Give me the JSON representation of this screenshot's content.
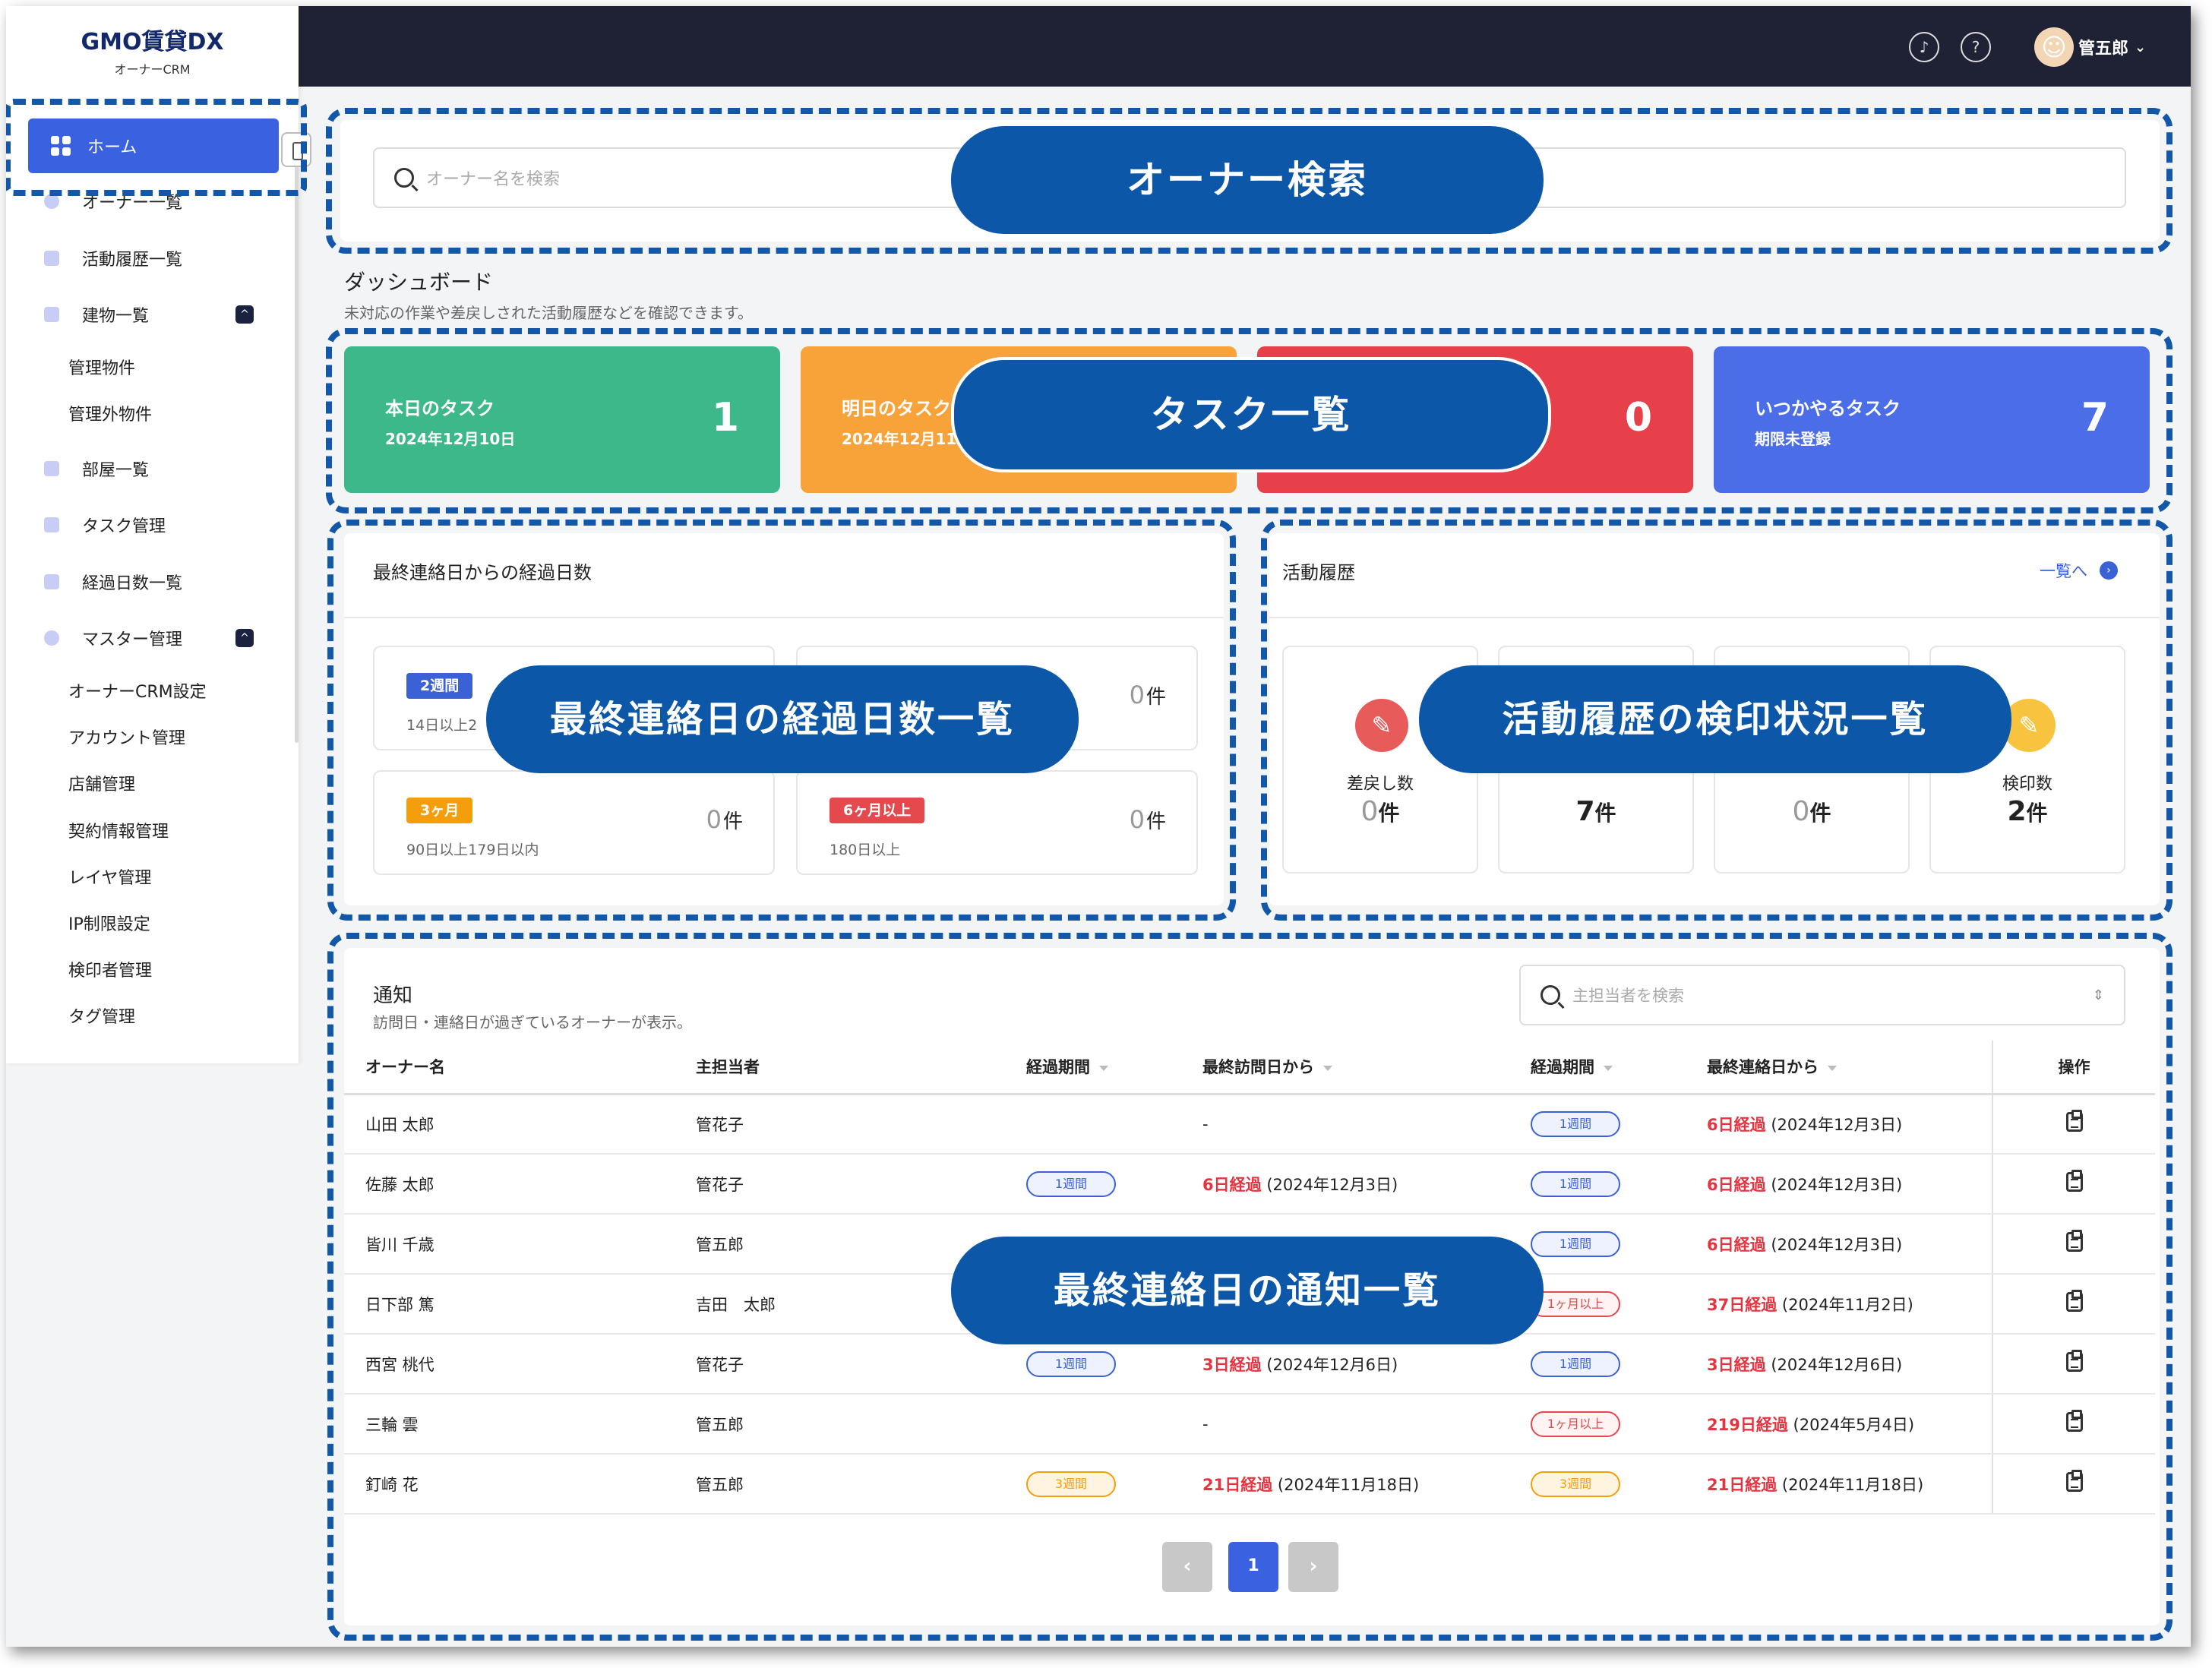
{
  "app": {
    "brand": "GMO賃貸DX",
    "product": "オーナーCRM"
  },
  "sidebar": {
    "home": "ホーム",
    "items": [
      "オーナー一覧",
      "活動履歴一覧",
      "建物一覧",
      "管理物件",
      "管理外物件",
      "部屋一覧",
      "タスク管理",
      "経過日数一覧",
      "マスター管理",
      "オーナーCRM設定",
      "アカウント管理",
      "店舗管理",
      "契約情報管理",
      "レイヤ管理",
      "IP制限設定",
      "検印者管理",
      "タグ管理"
    ]
  },
  "header": {
    "user": "管五郎"
  },
  "search": {
    "placeholder": "オーナー名を検索"
  },
  "dashboard": {
    "title": "ダッシュボード",
    "desc": "未対応の作業や差戻しされた活動履歴などを確認できます。"
  },
  "tasks": [
    {
      "title": "本日のタスク",
      "date": "2024年12月10日",
      "count": "1",
      "color": "#3cb88a"
    },
    {
      "title": "明日のタスク",
      "date": "2024年12月11日",
      "count": "",
      "color": "#f8a23a"
    },
    {
      "title": "",
      "date": "",
      "count": "0",
      "color": "#e8404a"
    },
    {
      "title": "いつかやるタスク",
      "date": "期限未登録",
      "count": "7",
      "color": "#4b6ee8"
    }
  ],
  "elapsed": {
    "title": "最終連絡日からの経過日数",
    "unit": "件",
    "items": [
      {
        "badge": "2週間",
        "sub": "14日以上2",
        "count": "",
        "color": "#3b61d6"
      },
      {
        "badge": "",
        "sub": "",
        "count": "0",
        "color": "#3b61d6"
      },
      {
        "badge": "3ヶ月",
        "sub": "90日以上179日以内",
        "count": "0",
        "color": "#f59e0b"
      },
      {
        "badge": "6ヶ月以上",
        "sub": "180日以上",
        "count": "0",
        "color": "#e5484d"
      }
    ]
  },
  "activity": {
    "title": "活動履歴",
    "link": "一覧へ",
    "unit": "件",
    "items": [
      {
        "label": "差戻し数",
        "count": "0"
      },
      {
        "label": "",
        "count": "7"
      },
      {
        "label": "",
        "count": "0"
      },
      {
        "label": "検印数",
        "count": "2"
      }
    ]
  },
  "notice": {
    "title": "通知",
    "desc": "訪問日・連絡日が過ぎているオーナーが表示。",
    "assignee_placeholder": "主担当者を検索",
    "headers": [
      "オーナー名",
      "主担当者",
      "経過期間",
      "最終訪問日から",
      "経過期間",
      "最終連絡日から",
      "操作"
    ],
    "rows": [
      {
        "owner": "山田 太郎",
        "manager": "管花子",
        "vtag": "",
        "vtype": "",
        "vdays": "-",
        "vdate": "",
        "ctag": "1週間",
        "ctype": "blue",
        "cdays": "6日経過",
        "cdate": "(2024年12月3日)"
      },
      {
        "owner": "佐藤 太郎",
        "manager": "管花子",
        "vtag": "1週間",
        "vtype": "blue",
        "vdays": "6日経過",
        "vdate": "(2024年12月3日)",
        "ctag": "1週間",
        "ctype": "blue",
        "cdays": "6日経過",
        "cdate": "(2024年12月3日)"
      },
      {
        "owner": "皆川 千歳",
        "manager": "管五郎",
        "vtag": "",
        "vtype": "",
        "vdays": "",
        "vdate": "",
        "ctag": "1週間",
        "ctype": "blue",
        "cdays": "6日経過",
        "cdate": "(2024年12月3日)"
      },
      {
        "owner": "日下部 篤",
        "manager": "吉田　太郎",
        "vtag": "",
        "vtype": "",
        "vdays": "",
        "vdate": "",
        "ctag": "1ヶ月以上",
        "ctype": "red",
        "cdays": "37日経過",
        "cdate": "(2024年11月2日)"
      },
      {
        "owner": "西宮 桃代",
        "manager": "管花子",
        "vtag": "1週間",
        "vtype": "blue",
        "vdays": "3日経過",
        "vdate": "(2024年12月6日)",
        "ctag": "1週間",
        "ctype": "blue",
        "cdays": "3日経過",
        "cdate": "(2024年12月6日)"
      },
      {
        "owner": "三輪 雲",
        "manager": "管五郎",
        "vtag": "",
        "vtype": "",
        "vdays": "-",
        "vdate": "",
        "ctag": "1ヶ月以上",
        "ctype": "red",
        "cdays": "219日経過",
        "cdate": "(2024年5月4日)"
      },
      {
        "owner": "釘崎 花",
        "manager": "管五郎",
        "vtag": "3週間",
        "vtype": "orange",
        "vdays": "21日経過",
        "vdate": "(2024年11月18日)",
        "ctag": "3週間",
        "ctype": "orange",
        "cdays": "21日経過",
        "cdate": "(2024年11月18日)"
      }
    ]
  },
  "pagination": {
    "current": "1",
    "prev": "‹",
    "next": "›"
  },
  "annotations": {
    "search": "オーナー検索",
    "tasks": "タスク一覧",
    "elapsed": "最終連絡日の経過日数一覧",
    "activity": "活動履歴の検印状況一覧",
    "notice": "最終連絡日の通知一覧"
  }
}
